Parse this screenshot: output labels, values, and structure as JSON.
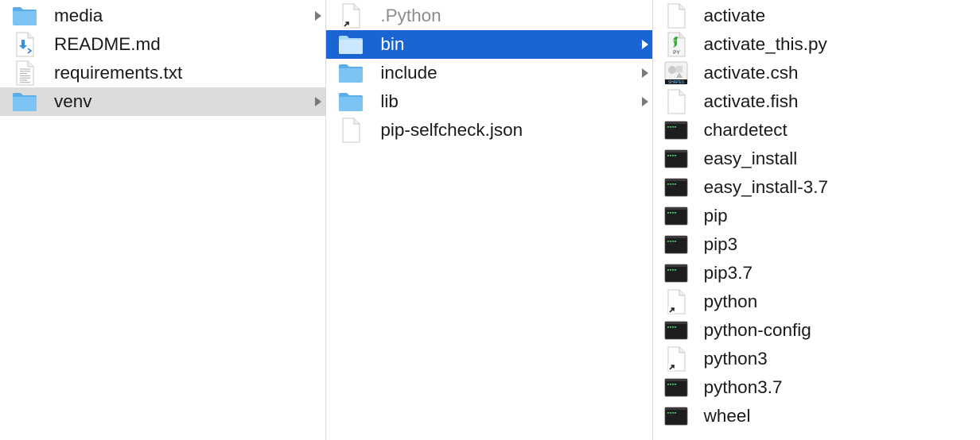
{
  "columns": [
    {
      "items": [
        {
          "label": "media",
          "icon": "folder-icon",
          "chevron": true
        },
        {
          "label": "README.md",
          "icon": "markdown-file-icon",
          "chevron": false
        },
        {
          "label": "requirements.txt",
          "icon": "text-file-icon",
          "chevron": false
        },
        {
          "label": "venv",
          "icon": "folder-icon",
          "chevron": true,
          "selected": "inactive"
        }
      ]
    },
    {
      "items": [
        {
          "label": ".Python",
          "icon": "alias-file-icon",
          "chevron": false,
          "dimmed": true
        },
        {
          "label": "bin",
          "icon": "folder-icon",
          "chevron": true,
          "selected": "active"
        },
        {
          "label": "include",
          "icon": "folder-icon",
          "chevron": true
        },
        {
          "label": "lib",
          "icon": "folder-icon",
          "chevron": true
        },
        {
          "label": "pip-selfcheck.json",
          "icon": "blank-file-icon",
          "chevron": false
        }
      ]
    },
    {
      "items": [
        {
          "label": "activate",
          "icon": "blank-file-icon"
        },
        {
          "label": "activate_this.py",
          "icon": "python-file-icon"
        },
        {
          "label": "activate.csh",
          "icon": "shapes-file-icon"
        },
        {
          "label": "activate.fish",
          "icon": "blank-file-icon"
        },
        {
          "label": "chardetect",
          "icon": "terminal-exec-icon"
        },
        {
          "label": "easy_install",
          "icon": "terminal-exec-icon"
        },
        {
          "label": "easy_install-3.7",
          "icon": "terminal-exec-icon"
        },
        {
          "label": "pip",
          "icon": "terminal-exec-icon"
        },
        {
          "label": "pip3",
          "icon": "terminal-exec-icon"
        },
        {
          "label": "pip3.7",
          "icon": "terminal-exec-icon"
        },
        {
          "label": "python",
          "icon": "alias-file-icon"
        },
        {
          "label": "python-config",
          "icon": "terminal-exec-icon"
        },
        {
          "label": "python3",
          "icon": "alias-file-icon"
        },
        {
          "label": "python3.7",
          "icon": "terminal-exec-icon"
        },
        {
          "label": "wheel",
          "icon": "terminal-exec-icon"
        }
      ]
    }
  ],
  "colors": {
    "selection_active": "#1a64d4",
    "selection_inactive": "#dcdcdc",
    "folder": "#6bbcf0",
    "dimmed_text": "#8c8c8c"
  },
  "icon_text": {
    "python_badge": "PY",
    "shapes_badge": "SHAPES"
  }
}
